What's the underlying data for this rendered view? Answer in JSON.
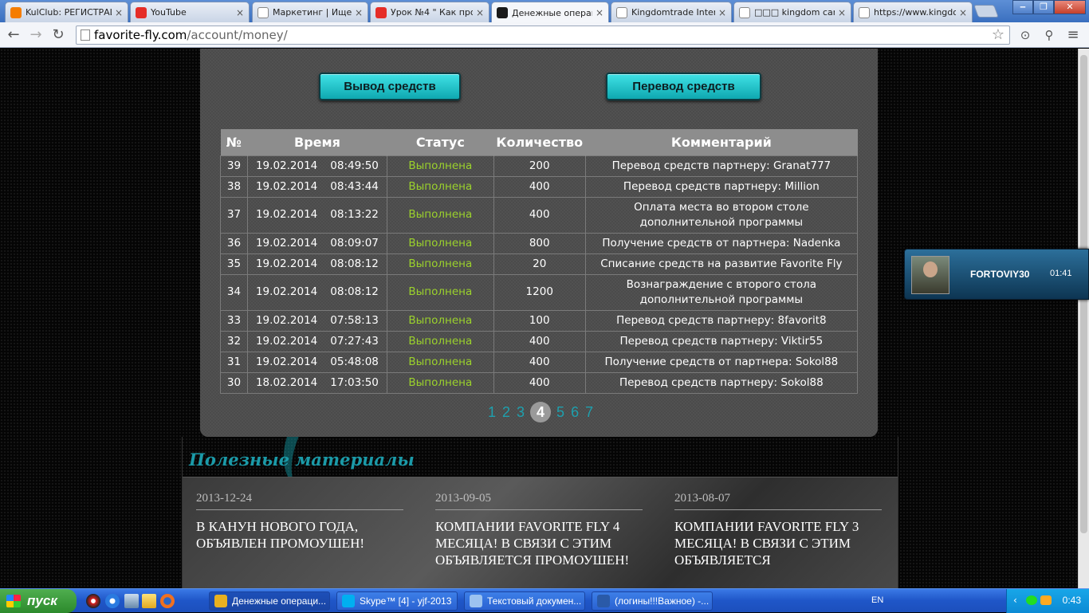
{
  "browser": {
    "tabs": [
      {
        "label": "KulClub: РЕГИСТРАЦ",
        "icon": "blogger-icon",
        "color": "#f57d00"
      },
      {
        "label": "YouTube",
        "icon": "youtube-icon",
        "color": "#e52d27"
      },
      {
        "label": "Маркетинг | Ищеш",
        "icon": "page-icon",
        "color": "#ffffff"
      },
      {
        "label": "Урок №4 \" Как про",
        "icon": "youtube-icon",
        "color": "#e52d27"
      },
      {
        "label": "Денежные операци",
        "icon": "ff-icon",
        "color": "#1a1a1a"
      },
      {
        "label": "Kingdomtrade Inter",
        "icon": "page-icon",
        "color": "#ffffff"
      },
      {
        "label": "□□□ kingdom carc",
        "icon": "page-icon",
        "color": "#ffffff"
      },
      {
        "label": "https://www.kingdo",
        "icon": "page-icon",
        "color": "#ffffff"
      }
    ],
    "address": {
      "host": "favorite-fly.com",
      "path": "/account/money/"
    }
  },
  "page": {
    "withdraw_label": "Вывод средств",
    "transfer_label": "Перевод средств",
    "table": {
      "headers": [
        "№",
        "Время",
        "Статус",
        "Количество",
        "Комментарий"
      ],
      "rows": [
        {
          "id": "39",
          "date": "19.02.2014",
          "time": "08:49:50",
          "status": "Выполнена",
          "amount": "200",
          "comment": "Перевод средств партнеру: Granat777",
          "tall": false
        },
        {
          "id": "38",
          "date": "19.02.2014",
          "time": "08:43:44",
          "status": "Выполнена",
          "amount": "400",
          "comment": "Перевод средств партнеру: Million",
          "tall": false
        },
        {
          "id": "37",
          "date": "19.02.2014",
          "time": "08:13:22",
          "status": "Выполнена",
          "amount": "400",
          "comment": "Оплата места во втором столе дополнительной программы",
          "tall": true
        },
        {
          "id": "36",
          "date": "19.02.2014",
          "time": "08:09:07",
          "status": "Выполнена",
          "amount": "800",
          "comment": "Получение средств от партнера: Nadenka",
          "tall": false
        },
        {
          "id": "35",
          "date": "19.02.2014",
          "time": "08:08:12",
          "status": "Выполнена",
          "amount": "20",
          "comment": "Списание средств на развитие Favorite Fly",
          "tall": false
        },
        {
          "id": "34",
          "date": "19.02.2014",
          "time": "08:08:12",
          "status": "Выполнена",
          "amount": "1200",
          "comment": "Вознаграждение с второго стола дополнительной программы",
          "tall": true
        },
        {
          "id": "33",
          "date": "19.02.2014",
          "time": "07:58:13",
          "status": "Выполнена",
          "amount": "100",
          "comment": "Перевод средств партнеру: 8favorit8",
          "tall": false
        },
        {
          "id": "32",
          "date": "19.02.2014",
          "time": "07:27:43",
          "status": "Выполнена",
          "amount": "400",
          "comment": "Перевод средств партнеру: Viktir55",
          "tall": false
        },
        {
          "id": "31",
          "date": "19.02.2014",
          "time": "05:48:08",
          "status": "Выполнена",
          "amount": "400",
          "comment": "Получение средств от партнера: Sokol88",
          "tall": false
        },
        {
          "id": "30",
          "date": "18.02.2014",
          "time": "17:03:50",
          "status": "Выполнена",
          "amount": "400",
          "comment": "Перевод средств партнеру: Sokol88",
          "tall": false
        }
      ]
    },
    "pagination": {
      "pages": [
        "1",
        "2",
        "3",
        "4",
        "5",
        "6",
        "7"
      ],
      "current": "4"
    },
    "materials_title": "Полезные материалы",
    "materials": [
      {
        "date": "2013-12-24",
        "title": "В канун нового года, объявлен промоушен!"
      },
      {
        "date": "2013-09-05",
        "title": "Компании Favorite Fly 4 месяца! В связи с этим объявляется промоушен!"
      },
      {
        "date": "2013-08-07",
        "title": "Компании Favorite Fly 3 месяца! В связи с этим объявляется"
      }
    ]
  },
  "skype_popup": {
    "name": "FORTOVIY30",
    "time": "01:41"
  },
  "taskbar": {
    "start_label": "пуск",
    "tasks": [
      {
        "label": "Денежные операци...",
        "icon": "chrome-icon",
        "color": "#e8b020"
      },
      {
        "label": "Skype™ [4] - yjf-2013",
        "icon": "skype-icon",
        "color": "#00aff0"
      },
      {
        "label": "Текстовый докумен...",
        "icon": "notepad-icon",
        "color": "#9cc3f0"
      },
      {
        "label": "(логины!!!Важное) -...",
        "icon": "word-icon",
        "color": "#2a5aa8"
      }
    ],
    "lang": "EN",
    "clock": "0:43"
  },
  "colors": {
    "accent": "#1ea0ae",
    "status_done": "#9bd22c",
    "button": "#20c4cc"
  }
}
